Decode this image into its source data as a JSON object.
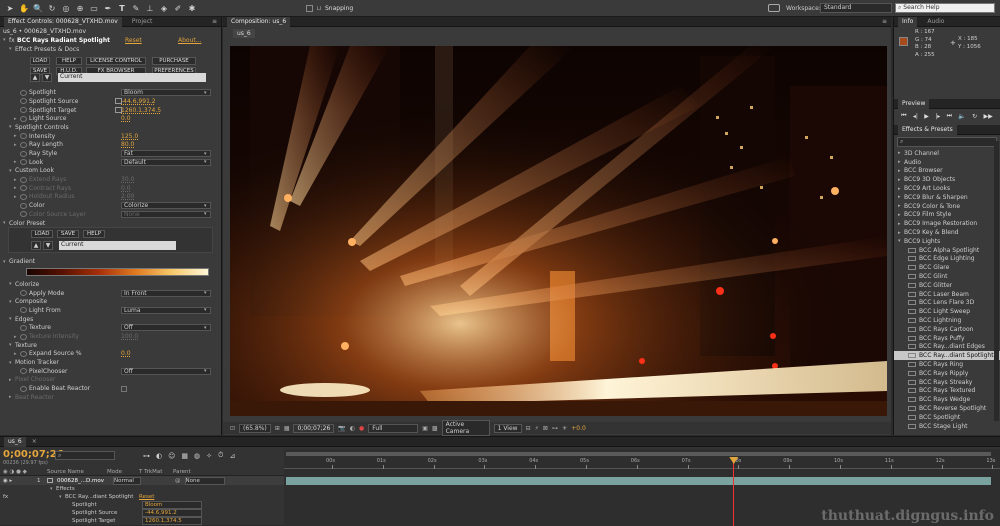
{
  "toolbar": {
    "snapping_label": "Snapping",
    "workspace_label": "Workspace:",
    "workspace_value": "Standard",
    "search_placeholder": "Search Help"
  },
  "effect_controls": {
    "tab_label": "Effect Controls: 000628_VTXHD.mov",
    "project_tab": "Project",
    "breadcrumb": "us_6 • 000628_VTXHD.mov",
    "fx_name": "BCC Rays Radiant Spotlight",
    "reset": "Reset",
    "about": "About...",
    "presets_label": "Effect Presets & Docs",
    "buttons_row1": [
      "LOAD",
      "HELP",
      "LICENSE CONTROL",
      "PURCHASE"
    ],
    "buttons_row2": [
      "SAVE",
      "H.U.D.",
      "FX BROWSER",
      "PREFERENCES"
    ],
    "preset_current": "Current",
    "props": [
      {
        "tw": "",
        "name": "Spotlight",
        "dd": "Bloom"
      },
      {
        "tw": "",
        "name": "Spotlight Source",
        "val": "-44.6,991.2"
      },
      {
        "tw": "",
        "name": "Spotlight Target",
        "val": "1260.1,374.5"
      },
      {
        "tw": "▸",
        "name": "Light Source",
        "val": "0.0"
      },
      {
        "tw": "▾",
        "name": "Spotlight Controls",
        "group": true
      },
      {
        "tw": "▸",
        "name": "Intensity",
        "val": "125.0"
      },
      {
        "tw": "▸",
        "name": "Ray Length",
        "val": "80.0"
      },
      {
        "tw": "",
        "name": "Ray Style",
        "dd": "Fat"
      },
      {
        "tw": "▸",
        "name": "Look",
        "dd": "Default"
      },
      {
        "tw": "▾",
        "name": "Custom Look",
        "group": true
      },
      {
        "tw": "▸",
        "name": "Extend Rays",
        "val": "30.0",
        "dim": true
      },
      {
        "tw": "▸",
        "name": "Contract Rays",
        "val": "0.0",
        "dim": true
      },
      {
        "tw": "▸",
        "name": "Holdout Radius",
        "val": "2.00",
        "dim": true
      },
      {
        "tw": "",
        "name": "Color",
        "dd": "Colorize"
      },
      {
        "tw": "",
        "name": "Color Source Layer",
        "dd": "None",
        "dim": true
      }
    ],
    "color_preset_label": "Color Preset",
    "preset_buttons": [
      "LOAD",
      "SAVE",
      "HELP"
    ],
    "preset2_current": "Current",
    "gradient_label": "Gradient",
    "props2": [
      {
        "tw": "▾",
        "name": "Colorize",
        "group": true
      },
      {
        "tw": "",
        "name": "Apply Mode",
        "dd": "In Front"
      },
      {
        "tw": "▾",
        "name": "Composite",
        "group": true
      },
      {
        "tw": "",
        "name": "Light From",
        "dd": "Luma"
      },
      {
        "tw": "▾",
        "name": "Edges",
        "group": true
      },
      {
        "tw": "",
        "name": "Texture",
        "dd": "Off"
      },
      {
        "tw": "▸",
        "name": "Texture Intensity",
        "val": "100.0",
        "dim": true
      },
      {
        "tw": "▾",
        "name": "Texture",
        "group": true
      },
      {
        "tw": "▸",
        "name": "Expand Source %",
        "val": "0.0"
      },
      {
        "tw": "▾",
        "name": "Motion Tracker",
        "group": true
      },
      {
        "tw": "",
        "name": "PixelChooser",
        "dd": "Off"
      },
      {
        "tw": "▸",
        "name": "Pixel Chooser",
        "dim": true,
        "group": true
      },
      {
        "tw": "",
        "name": "Enable Beat Reactor",
        "check": true
      },
      {
        "tw": "▸",
        "name": "Beat Reactor",
        "dim": true,
        "group": true
      }
    ]
  },
  "composition": {
    "tab_label": "Composition: us_6",
    "sub_tab": "us_6",
    "zoom": "(65.8%)",
    "timecode": "0;00;07;26",
    "quality": "Full",
    "camera": "Active Camera",
    "view": "1 View",
    "exposure": "+0.0"
  },
  "info": {
    "tab": "Info",
    "audio_tab": "Audio",
    "r": "R : 167",
    "g": "G : 74",
    "b": "B : 28",
    "a": "A : 255",
    "x": "X : 185",
    "y": "Y : 1056",
    "swatch_color": "#a74a1c"
  },
  "preview": {
    "tab": "Preview"
  },
  "effects_presets": {
    "tab": "Effects & Presets",
    "items": [
      {
        "type": "folder",
        "open": false,
        "label": "3D Channel"
      },
      {
        "type": "folder",
        "open": false,
        "label": "Audio"
      },
      {
        "type": "folder",
        "open": false,
        "label": "BCC Browser"
      },
      {
        "type": "folder",
        "open": false,
        "label": "BCC9 3D Objects"
      },
      {
        "type": "folder",
        "open": false,
        "label": "BCC9 Art Looks"
      },
      {
        "type": "folder",
        "open": false,
        "label": "BCC9 Blur & Sharpen"
      },
      {
        "type": "folder",
        "open": false,
        "label": "BCC9 Color & Tone"
      },
      {
        "type": "folder",
        "open": false,
        "label": "BCC9 Film Style"
      },
      {
        "type": "folder",
        "open": false,
        "label": "BCC9 Image Restoration"
      },
      {
        "type": "folder",
        "open": false,
        "label": "BCC9 Key & Blend"
      },
      {
        "type": "folder",
        "open": true,
        "label": "BCC9 Lights"
      },
      {
        "type": "fx",
        "label": "BCC Alpha Spotlight"
      },
      {
        "type": "fx",
        "label": "BCC Edge Lighting"
      },
      {
        "type": "fx",
        "label": "BCC Glare"
      },
      {
        "type": "fx",
        "label": "BCC Glint"
      },
      {
        "type": "fx",
        "label": "BCC Glitter"
      },
      {
        "type": "fx",
        "label": "BCC Laser Beam"
      },
      {
        "type": "fx",
        "label": "BCC Lens Flare 3D"
      },
      {
        "type": "fx",
        "label": "BCC Light Sweep"
      },
      {
        "type": "fx",
        "label": "BCC Lightning"
      },
      {
        "type": "fx",
        "label": "BCC Rays Cartoon"
      },
      {
        "type": "fx",
        "label": "BCC Rays Puffy"
      },
      {
        "type": "fx",
        "label": "BCC Ray...diant Edges"
      },
      {
        "type": "fx",
        "label": "BCC Ray...diant Spotlight",
        "selected": true
      },
      {
        "type": "fx",
        "label": "BCC Rays Ring"
      },
      {
        "type": "fx",
        "label": "BCC Rays Ripply"
      },
      {
        "type": "fx",
        "label": "BCC Rays Streaky"
      },
      {
        "type": "fx",
        "label": "BCC Rays Textured"
      },
      {
        "type": "fx",
        "label": "BCC Rays Wedge"
      },
      {
        "type": "fx",
        "label": "BCC Reverse Spotlight"
      },
      {
        "type": "fx",
        "label": "BCC Spotlight"
      },
      {
        "type": "fx",
        "label": "BCC Stage Light"
      }
    ]
  },
  "timeline": {
    "tab": "us_6",
    "timecode": "0;00;07;26",
    "fps": "00236 (29.97 fps)",
    "col_source": "Source Name",
    "col_mode": "Mode",
    "col_trkmat": "T TrkMat",
    "col_parent": "Parent",
    "layer_num": "1",
    "layer_name": "000628_...D.mov",
    "layer_mode": "Normal",
    "layer_parent": "None",
    "effects_label": "Effects",
    "fx_row": "BCC Ray...diant Spotlight",
    "fx_reset": "Reset",
    "sub_rows": [
      {
        "name": "Spotlight",
        "val": "Bloom"
      },
      {
        "name": "Spotlight Source",
        "val": "-44.6,991.2"
      },
      {
        "name": "Spotlight Target",
        "val": "1260.1,374.5"
      }
    ],
    "ruler": [
      "00s",
      "01s",
      "02s",
      "03s",
      "04s",
      "05s",
      "06s",
      "07s",
      "08s",
      "09s",
      "10s",
      "11s",
      "12s",
      "13s"
    ],
    "playhead_seconds": 7.9
  },
  "watermark": "thuthuat.digngus.info"
}
